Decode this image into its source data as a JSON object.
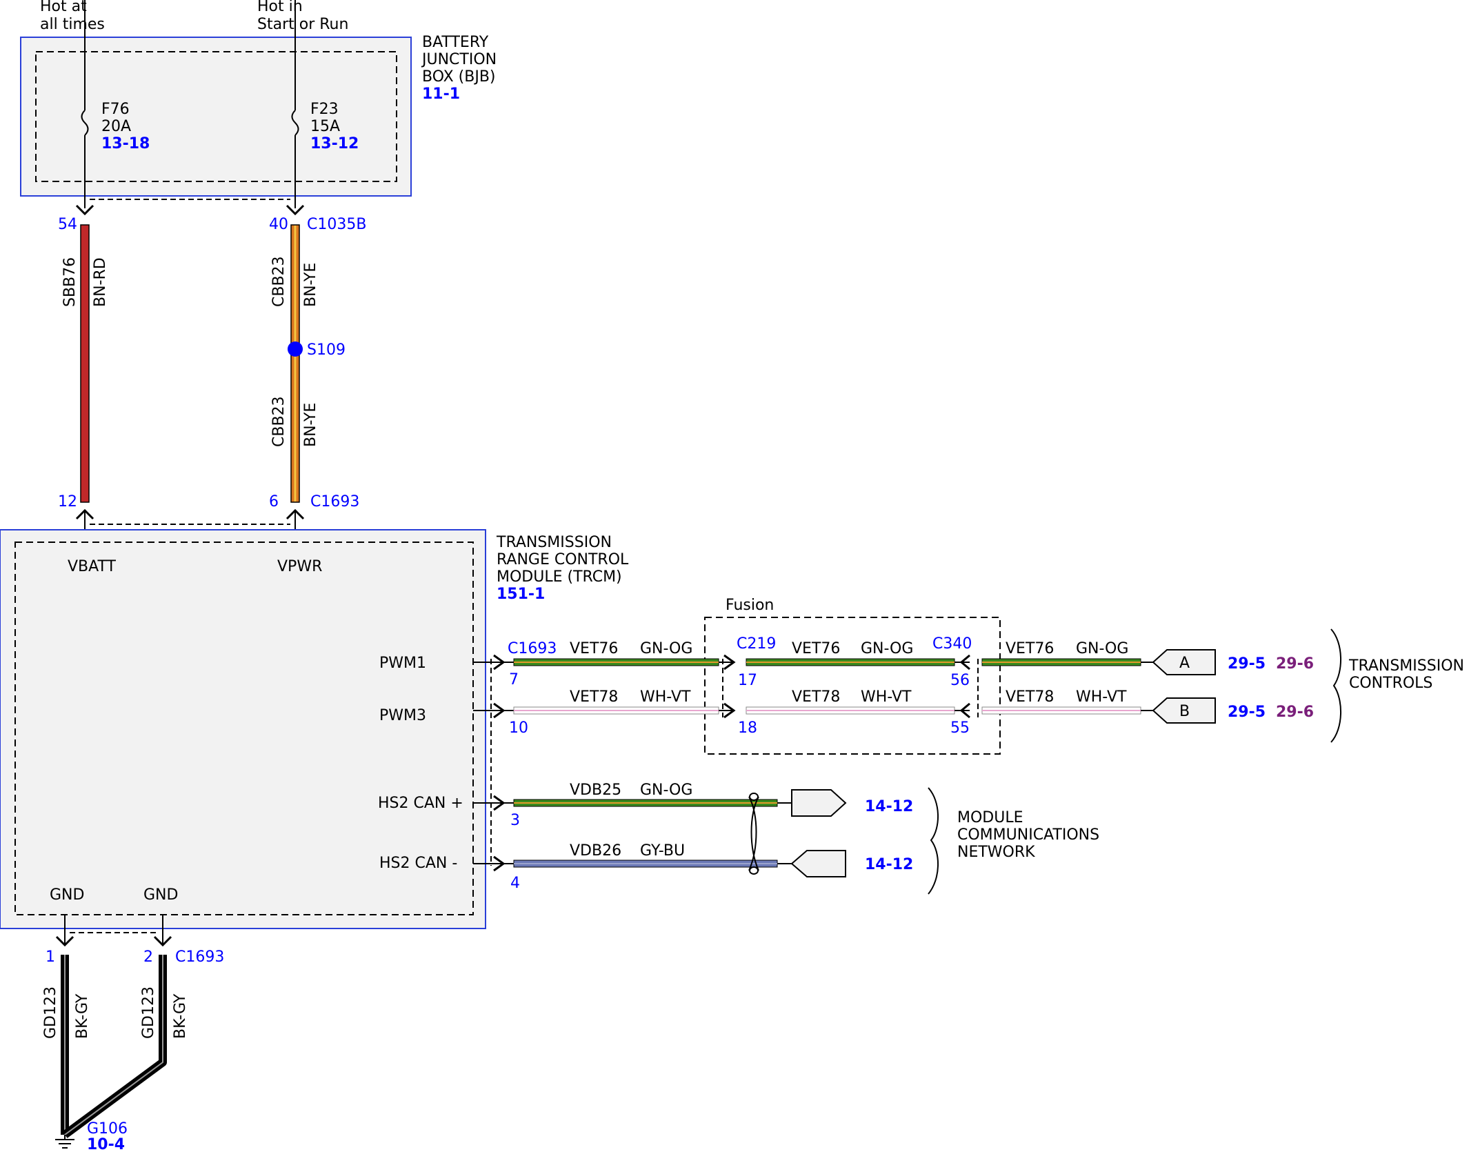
{
  "sources": {
    "hot_at_all_times": [
      "Hot at",
      "all times"
    ],
    "hot_in_start_run": [
      "Hot in",
      "Start or Run"
    ]
  },
  "bjb": {
    "title": [
      "BATTERY",
      "JUNCTION",
      "BOX (BJB)"
    ],
    "ref": "11-1",
    "fuses": [
      {
        "name": "F76",
        "rating": "20A",
        "ref": "13-18"
      },
      {
        "name": "F23",
        "rating": "15A",
        "ref": "13-12"
      }
    ]
  },
  "upper_wires": {
    "left": {
      "top_pin": "54",
      "circuit": "SBB76",
      "color": "BN-RD",
      "bottom_pin": "12",
      "stripe": "#c0282a"
    },
    "right": {
      "top_pin": "40",
      "connector_top": "C1035B",
      "circuit": "CBB23",
      "color": "BN-YE",
      "splice": "S109",
      "bottom_pin": "6",
      "connector_bottom": "C1693",
      "stripe": "#d9751f",
      "tracer": "#f5c542"
    }
  },
  "trcm": {
    "title": [
      "TRANSMISSION",
      "RANGE CONTROL",
      "MODULE (TRCM)"
    ],
    "ref": "151-1",
    "pins": {
      "vbatt": "VBATT",
      "vpwr": "VPWR",
      "pwm1": "PWM1",
      "pwm3": "PWM3",
      "can_plus": "HS2 CAN +",
      "can_minus": "HS2 CAN -",
      "gnd1": "GND",
      "gnd2": "GND"
    }
  },
  "fusion": {
    "label": "Fusion"
  },
  "pwm1_row": {
    "connector_a": "C1693",
    "pin_a": "7",
    "circuit": "VET76",
    "color": "GN-OG",
    "connector_b": "C219",
    "pin_b": "17",
    "connector_c": "C340",
    "pin_c": "56",
    "terminal": "A",
    "ref1": "29-5",
    "ref2": "29-6"
  },
  "pwm3_row": {
    "pin_a": "10",
    "circuit": "VET78",
    "color": "WH-VT",
    "pin_b": "18",
    "pin_c": "55",
    "terminal": "B",
    "ref1": "29-5",
    "ref2": "29-6"
  },
  "transmission_controls": [
    "TRANSMISSION",
    "CONTROLS"
  ],
  "can_rows": [
    {
      "pin": "3",
      "circuit": "VDB25",
      "color": "GN-OG",
      "ref": "14-12"
    },
    {
      "pin": "4",
      "circuit": "VDB26",
      "color": "GY-BU",
      "ref": "14-12"
    }
  ],
  "module_comm": [
    "MODULE",
    "COMMUNICATIONS",
    "NETWORK"
  ],
  "ground": {
    "pin1": "1",
    "pin2": "2",
    "connector": "C1693",
    "circuit": "GD123",
    "color": "BK-GY",
    "ground_id": "G106",
    "ref": "10-4"
  },
  "colors": {
    "module_border": "#2a3fd8",
    "module_fill": "#f2f2f2",
    "connector_blue": "#0000ff",
    "green": "#3a8a1e",
    "orange": "#d9751f",
    "gy_bu": "#6a78b5",
    "pink": "#e8a6cf"
  }
}
